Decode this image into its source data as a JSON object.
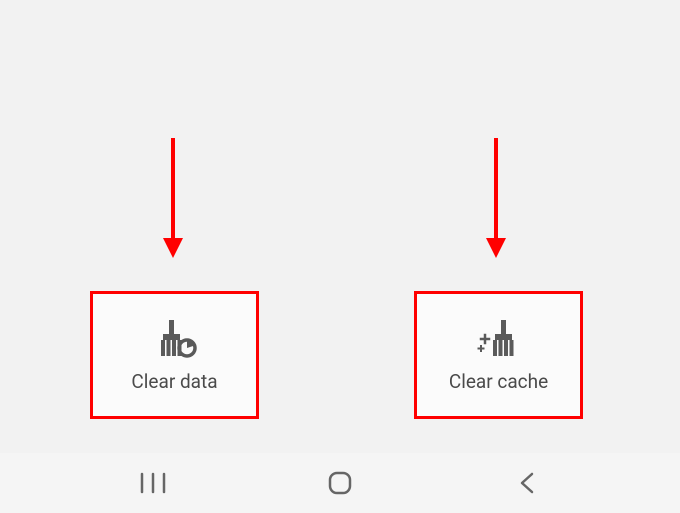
{
  "actions": {
    "clear_data": {
      "label": "Clear data",
      "icon": "broom-chart-icon"
    },
    "clear_cache": {
      "label": "Clear cache",
      "icon": "broom-sparkle-icon"
    }
  },
  "nav": {
    "recents": "recents",
    "home": "home",
    "back": "back"
  },
  "annotation_color": "#ff0000"
}
